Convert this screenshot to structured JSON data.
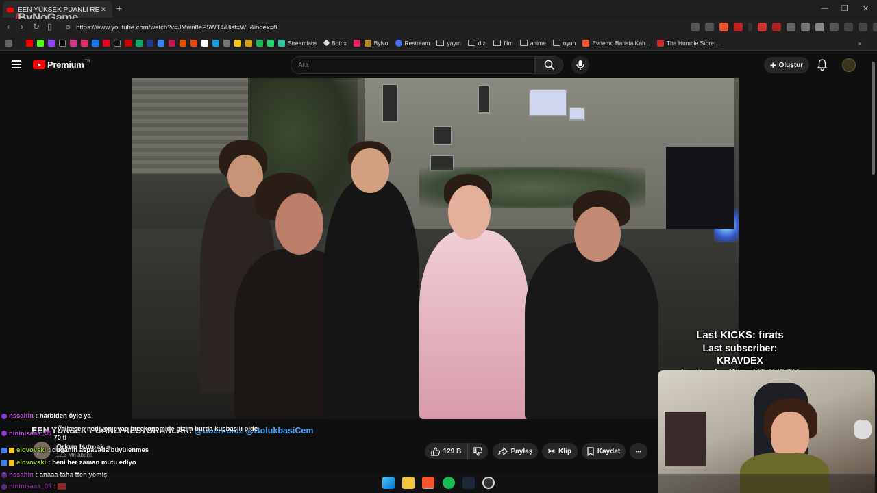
{
  "browser": {
    "tab_title": "EEN YÜKSEK PUANLI RESTORANLAR!",
    "new_tab": "+",
    "tab_close": "✕",
    "window_controls": [
      "—",
      "❐",
      "✕"
    ],
    "url": "https://www.youtube.com/watch?v=JMwn8eP5WT4&list=WL&index=8",
    "bookmarks": [
      "Streamlabs",
      "Botrix",
      "ByNo",
      "Restream",
      "yayın",
      "dizi",
      "film",
      "anime",
      "oyun",
      "Evdemo Barista Kah...",
      "The Humble Store:..."
    ],
    "more_bookmarks": "»"
  },
  "overlay_logo": {
    "prefix": "/",
    "name": "ByNoGame"
  },
  "youtube": {
    "logo_text": "Premium",
    "logo_region": "TR",
    "search_placeholder": "Ara",
    "create_label": "Oluştur"
  },
  "video": {
    "title_main": "EEN YÜKSEK PUANLI RESTORANLAR! ",
    "title_mentions": "@uberkuloz @BolukbasiCem",
    "channel_name": "Orkun Işıtmak",
    "channel_verified": "◉",
    "subscribers": "12,3 Mn abone",
    "likes": "129 B",
    "share": "Paylaş",
    "clip": "Klip",
    "save": "Kaydet",
    "more": "•••"
  },
  "stream_stats": {
    "last_kicks": "Last KICKS: firats",
    "last_subscriber": "Last subscriber: KRAVDEX",
    "last_sub_gifter": "Last sub gifter: KRAVDEX"
  },
  "chat": [
    {
      "user": "nssahin",
      "message": ": harbiden öyle ya"
    },
    {
      "user": "nininisaaa_05",
      "message": ": valla sen nediyon evap bu ekonomide bizim burda kuşbaşılı pide 70 tl"
    },
    {
      "user": "elovovski",
      "message": ": duganin aspavada büyülenmes"
    },
    {
      "user": "elovovski",
      "message": ": beni her zaman mutu ediyo"
    },
    {
      "user": "nssahin",
      "message": ": anaaa taha tten yemiş"
    },
    {
      "user": "nininisaaa_05",
      "message": ":"
    }
  ],
  "colors": {
    "accent": "#ff0000",
    "chat_user_purple": "#c34ede",
    "chat_user_green": "#9acd32",
    "link_blue": "#3ea6ff"
  }
}
